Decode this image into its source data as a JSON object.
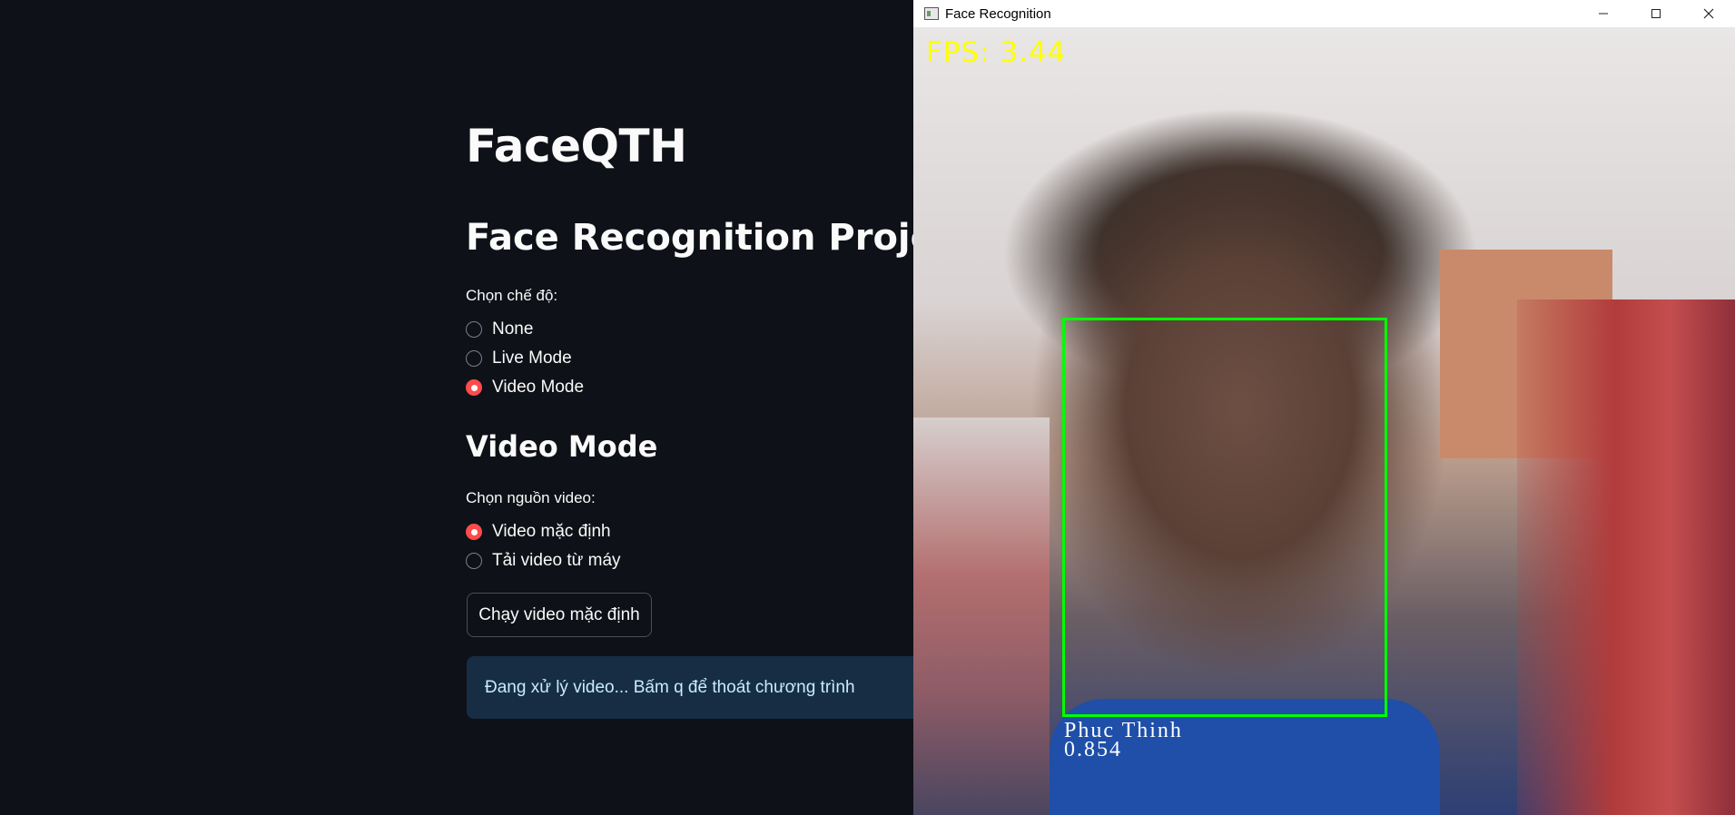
{
  "app": {
    "title": "FaceQTH",
    "subheader": "Face Recognition Project",
    "mode_label": "Chọn chế độ:",
    "modes": [
      {
        "label": "None",
        "selected": false
      },
      {
        "label": "Live Mode",
        "selected": false
      },
      {
        "label": "Video Mode",
        "selected": true
      }
    ],
    "section_header": "Video Mode",
    "source_label": "Chọn nguồn video:",
    "sources": [
      {
        "label": "Video mặc định",
        "selected": true
      },
      {
        "label": "Tải video từ máy",
        "selected": false
      }
    ],
    "run_button_label": "Chạy video mặc định",
    "info_message": "Đang xử lý video... Bấm q để thoát chương trình",
    "colors": {
      "background": "#0e1117",
      "accent": "#ff4b4b",
      "info_background": "#172d43",
      "info_text": "#c7ebff"
    }
  },
  "cv_window": {
    "title": "Face Recognition",
    "minimize_icon": "minimize-icon",
    "maximize_icon": "maximize-icon",
    "close_icon": "close-icon",
    "fps_text": "FPS: 3.44",
    "detection": {
      "name": "Phuc Thinh",
      "score": "0.854",
      "box_color": "#00ff00"
    }
  }
}
